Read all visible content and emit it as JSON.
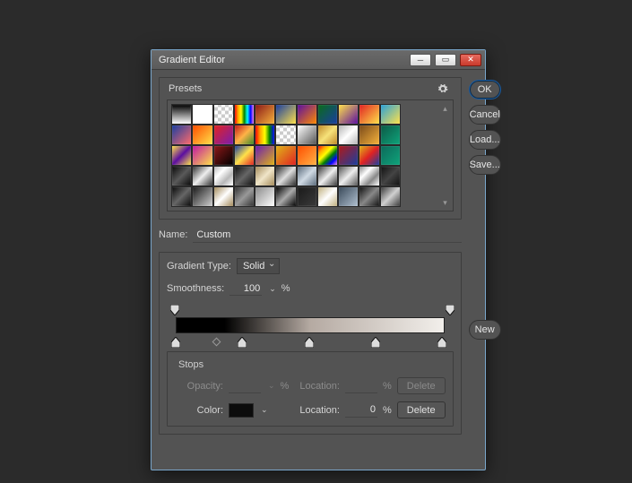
{
  "window": {
    "title": "Gradient Editor"
  },
  "buttons": {
    "ok": "OK",
    "cancel": "Cancel",
    "load": "Load...",
    "save": "Save...",
    "new": "New",
    "delete": "Delete"
  },
  "presets": {
    "label": "Presets",
    "swatches": [
      "linear-gradient(#000,#fff)",
      "linear-gradient(#fff,#fff)",
      "repeating-conic-gradient(#ccc 0 25%,#fff 0 50%) 0/8px 8px",
      "linear-gradient(90deg,red,orange,yellow,green,cyan,blue,violet)",
      "linear-gradient(135deg,#8a1818,#f6b33c)",
      "linear-gradient(135deg,#1a3ea0,#ffe14a)",
      "linear-gradient(135deg,#5b0ea0,#ff8a00)",
      "linear-gradient(135deg,#0a6b1a,#1a3ea0)",
      "linear-gradient(135deg,#ffe14a,#5b0ea0)",
      "linear-gradient(135deg,#e02222,#ffe14a)",
      "linear-gradient(135deg,#2aa1d8,#ffe14a)",
      "linear-gradient(135deg,#1a3ea0,#ff6b6b)",
      "linear-gradient(135deg,#ff4d00,#ffe14a)",
      "linear-gradient(135deg,#e02222,#7a1db0)",
      "linear-gradient(135deg,#c11818,#ffb347,#3a8a2a)",
      "linear-gradient(90deg,red,orange,yellow,green,blue)",
      "repeating-conic-gradient(#ccc 0 25%,#fff 0 50%) 0/8px 8px",
      "linear-gradient(135deg,rgba(255,255,255,1),rgba(255,255,255,0))",
      "linear-gradient(135deg,#c08a2a,#f6e27a,#c08a2a)",
      "linear-gradient(135deg,#b5b5b5,#fff,#b5b5b5)",
      "linear-gradient(135deg,#7a4a1a,#f6b33c)",
      "linear-gradient(135deg,#0c5a46,#0fa37a)",
      "linear-gradient(135deg,#ffe14a,#5b0ea0,#ffe14a)",
      "linear-gradient(135deg,#c019a0,#ffe14a)",
      "linear-gradient(135deg,#8a1818,#000)",
      "linear-gradient(135deg,#1a3ea0,#ffe14a,#e02222)",
      "linear-gradient(135deg,#6b1db0,#e0b418)",
      "linear-gradient(135deg,#e0b418,#e02222)",
      "linear-gradient(135deg,#ff4d00,#ffb347)",
      "linear-gradient(135deg,red,orange,yellow,green,blue,violet)",
      "linear-gradient(135deg,#b01919,#1a3ea0)",
      "linear-gradient(135deg,#e0b418,#e02222,#1a3ea0)",
      "linear-gradient(135deg,#0c6a5a,#0fa37a)",
      "linear-gradient(135deg,#0a0a0a,#5a5a5a,#0a0a0a)",
      "linear-gradient(135deg,#333,#eee,#333)",
      "linear-gradient(135deg,#b8b8b8,#fff,#b8b8b8,#fff)",
      "linear-gradient(135deg,#111,#666,#111)",
      "linear-gradient(135deg,#a38a5a,#f0e5c8,#a38a5a)",
      "linear-gradient(135deg,#2a2a2a,#ddd,#2a2a2a)",
      "linear-gradient(135deg,#5a6a7a,#d0dae4,#5a6a7a)",
      "linear-gradient(135deg,#3a3a3a,#eee,#3a3a3a)",
      "linear-gradient(135deg,#555,#eee,#555)",
      "linear-gradient(135deg,#888,#fff,#888,#fff)",
      "linear-gradient(135deg,#111,#444,#111)",
      "linear-gradient(135deg,#0a0a0a,#666,#0a0a0a)",
      "linear-gradient(135deg,#1a1a1a,#d0d0d0)",
      "linear-gradient(135deg,#a38a5a,#fff,#a38a5a)",
      "linear-gradient(135deg,#333,#999,#333)",
      "linear-gradient(135deg,#8a8a8a,#fff)",
      "linear-gradient(135deg,#000,#aaa,#000)",
      "linear-gradient(135deg,#1a1a1a,#3a3a3a)",
      "linear-gradient(135deg,#c0b080,#fff,#c0b080)",
      "linear-gradient(135deg,#3a4a5a,#b0c0d0)",
      "linear-gradient(135deg,#111,#888,#111)",
      "linear-gradient(135deg,#3a3a3a,#d0d0d0,#3a3a3a)"
    ]
  },
  "name": {
    "label": "Name:",
    "value": "Custom"
  },
  "gradient": {
    "type_label": "Gradient Type:",
    "type_value": "Solid",
    "smooth_label": "Smoothness:",
    "smooth_value": "100",
    "percent": "%"
  },
  "stops": {
    "title": "Stops",
    "opacity_label": "Opacity:",
    "opacity_value": "",
    "color_label": "Color:",
    "location_label": "Location:",
    "location_value_opacity": "",
    "location_value_color": "0"
  },
  "opacity_stops_pos": [
    2,
    98
  ],
  "color_stops_pos": [
    0,
    25,
    50,
    75,
    100
  ],
  "midpoints_pos": [
    14
  ]
}
